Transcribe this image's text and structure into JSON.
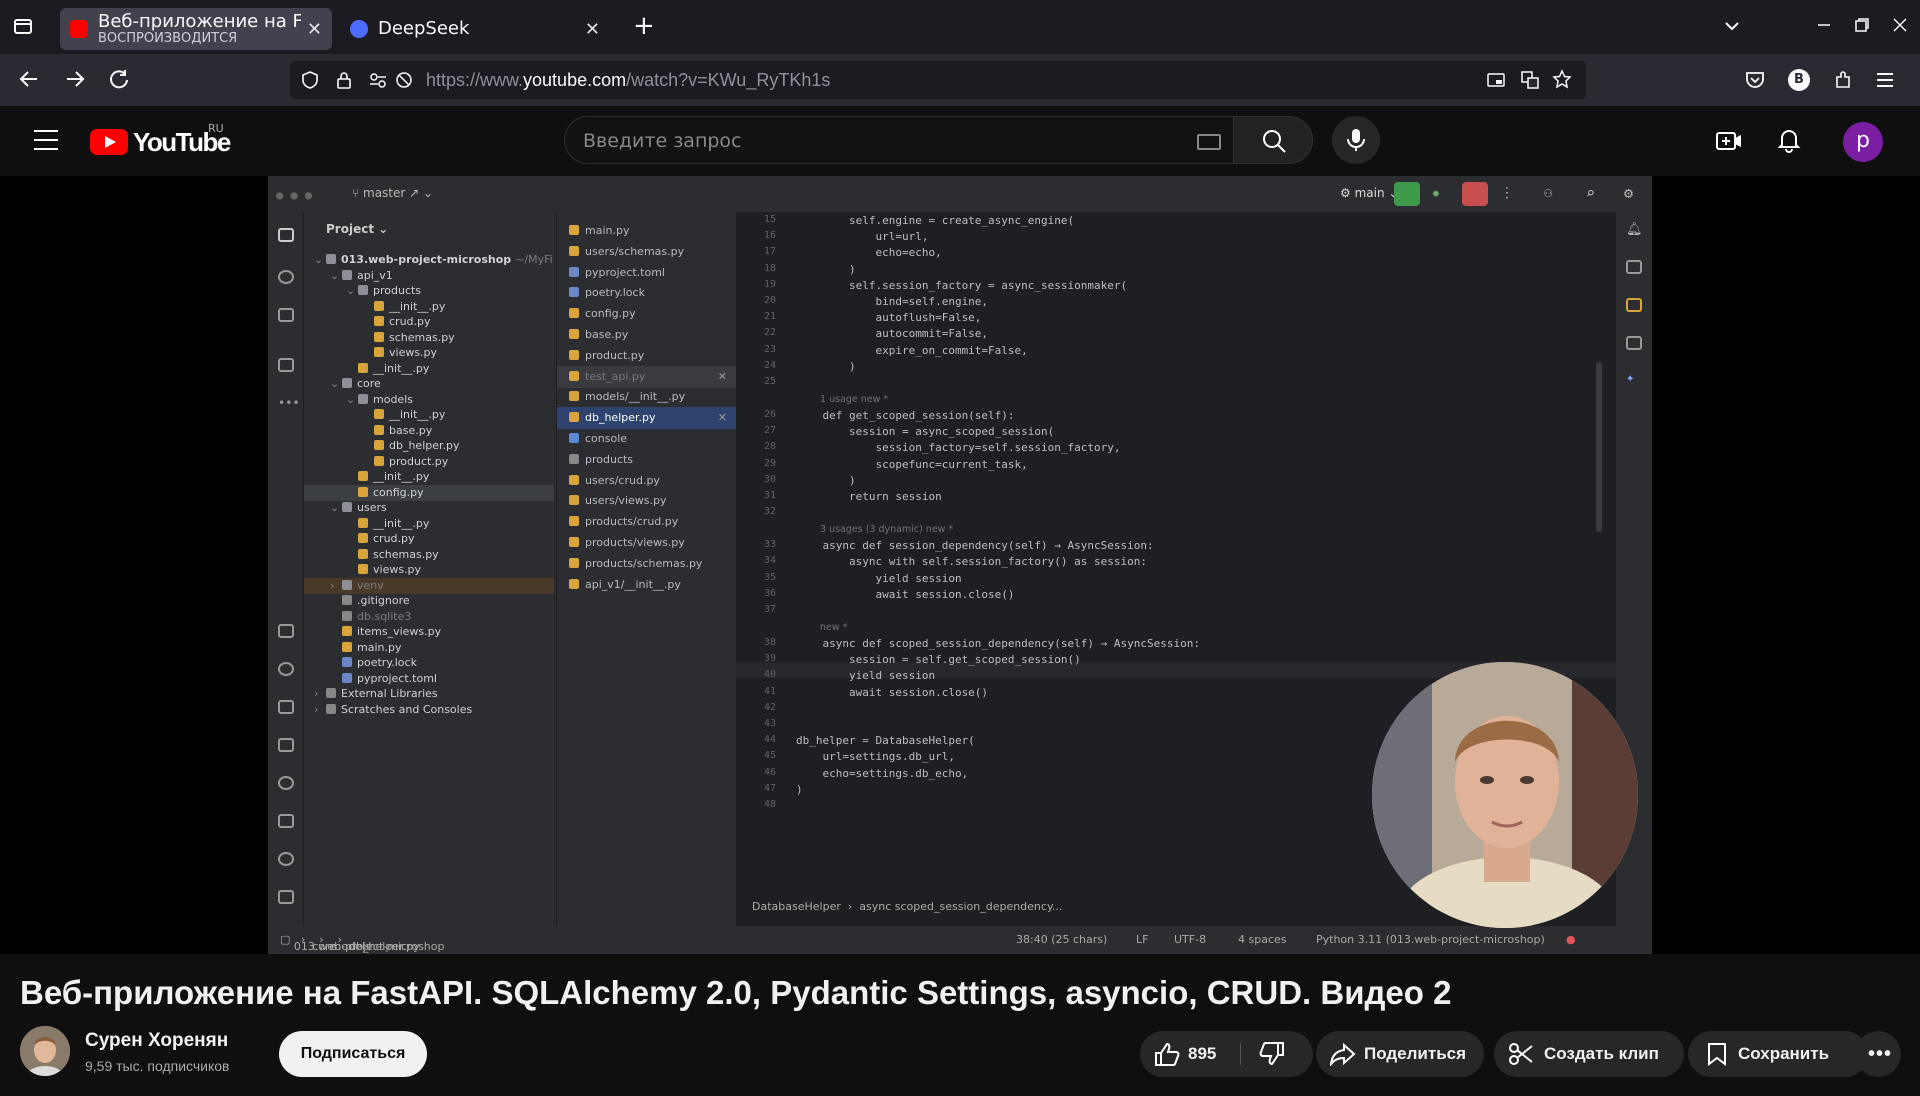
{
  "browser": {
    "tabs": [
      {
        "title": "Веб-приложение на FastAPI",
        "subtitle": "ВОСПРОИЗВОДИТСЯ",
        "active": true
      },
      {
        "title": "DeepSeek",
        "active": false
      }
    ],
    "url_prefix": "https://www.",
    "url_domain": "youtube.com",
    "url_path": "/watch?v=KWu_RyTKh1s",
    "profile_initial": "B"
  },
  "youtube": {
    "logo_text": "YouTube",
    "region": "RU",
    "search_placeholder": "Введите запрос",
    "avatar_initial": "p"
  },
  "ide": {
    "branch": "master",
    "run_config": "main",
    "project_label": "Project",
    "tree": [
      {
        "indent": 0,
        "label": "013.web-project-microshop",
        "suffix": "~/MyFi",
        "kind": "folder",
        "bold": true
      },
      {
        "indent": 1,
        "label": "api_v1",
        "kind": "folder"
      },
      {
        "indent": 2,
        "label": "products",
        "kind": "folder"
      },
      {
        "indent": 3,
        "label": "__init__.py",
        "kind": "py"
      },
      {
        "indent": 3,
        "label": "crud.py",
        "kind": "py"
      },
      {
        "indent": 3,
        "label": "schemas.py",
        "kind": "py"
      },
      {
        "indent": 3,
        "label": "views.py",
        "kind": "py"
      },
      {
        "indent": 2,
        "label": "__init__.py",
        "kind": "py"
      },
      {
        "indent": 1,
        "label": "core",
        "kind": "folder"
      },
      {
        "indent": 2,
        "label": "models",
        "kind": "folder"
      },
      {
        "indent": 3,
        "label": "__init__.py",
        "kind": "py"
      },
      {
        "indent": 3,
        "label": "base.py",
        "kind": "py"
      },
      {
        "indent": 3,
        "label": "db_helper.py",
        "kind": "py"
      },
      {
        "indent": 3,
        "label": "product.py",
        "kind": "py"
      },
      {
        "indent": 2,
        "label": "__init__.py",
        "kind": "py"
      },
      {
        "indent": 2,
        "label": "config.py",
        "kind": "py",
        "selected": true
      },
      {
        "indent": 1,
        "label": "users",
        "kind": "folder"
      },
      {
        "indent": 2,
        "label": "__init__.py",
        "kind": "py"
      },
      {
        "indent": 2,
        "label": "crud.py",
        "kind": "py"
      },
      {
        "indent": 2,
        "label": "schemas.py",
        "kind": "py"
      },
      {
        "indent": 2,
        "label": "views.py",
        "kind": "py"
      },
      {
        "indent": 1,
        "label": "venv",
        "kind": "folder",
        "venv": true
      },
      {
        "indent": 1,
        "label": ".gitignore",
        "kind": "other"
      },
      {
        "indent": 1,
        "label": "db.sqlite3",
        "kind": "other",
        "dim": true
      },
      {
        "indent": 1,
        "label": "items_views.py",
        "kind": "py"
      },
      {
        "indent": 1,
        "label": "main.py",
        "kind": "py"
      },
      {
        "indent": 1,
        "label": "poetry.lock",
        "kind": "toml"
      },
      {
        "indent": 1,
        "label": "pyproject.toml",
        "kind": "toml"
      },
      {
        "indent": 0,
        "label": "External Libraries",
        "kind": "lib"
      },
      {
        "indent": 0,
        "label": "Scratches and Consoles",
        "kind": "lib"
      }
    ],
    "open_files": [
      {
        "label": "main.py"
      },
      {
        "label": "users/schemas.py"
      },
      {
        "label": "pyproject.toml",
        "kind": "toml"
      },
      {
        "label": "poetry.lock",
        "kind": "toml"
      },
      {
        "label": "config.py"
      },
      {
        "label": "base.py"
      },
      {
        "label": "product.py"
      },
      {
        "label": "test_api.py",
        "state": "dim"
      },
      {
        "label": "models/__init__.py"
      },
      {
        "label": "db_helper.py",
        "state": "hl"
      },
      {
        "label": "console",
        "kind": "console"
      },
      {
        "label": "products",
        "kind": "table"
      },
      {
        "label": "users/crud.py"
      },
      {
        "label": "users/views.py"
      },
      {
        "label": "products/crud.py"
      },
      {
        "label": "products/views.py"
      },
      {
        "label": "products/schemas.py"
      },
      {
        "label": "api_v1/__init__.py"
      }
    ],
    "code_lines": [
      {
        "n": "15",
        "text": "        self.engine = create_async_engine("
      },
      {
        "n": "16",
        "text": "            url=url,"
      },
      {
        "n": "17",
        "text": "            echo=echo,"
      },
      {
        "n": "18",
        "text": "        )"
      },
      {
        "n": "19",
        "text": "        self.session_factory = async_sessionmaker("
      },
      {
        "n": "20",
        "text": "            bind=self.engine,"
      },
      {
        "n": "21",
        "text": "            autoflush=False,"
      },
      {
        "n": "22",
        "text": "            autocommit=False,"
      },
      {
        "n": "23",
        "text": "            expire_on_commit=False,"
      },
      {
        "n": "24",
        "text": "        )"
      },
      {
        "n": "25",
        "text": ""
      },
      {
        "hint": "1 usage    new *"
      },
      {
        "n": "26",
        "text": "    def get_scoped_session(self):"
      },
      {
        "n": "27",
        "text": "        session = async_scoped_session("
      },
      {
        "n": "28",
        "text": "            session_factory=self.session_factory,"
      },
      {
        "n": "29",
        "text": "            scopefunc=current_task,"
      },
      {
        "n": "30",
        "text": "        )"
      },
      {
        "n": "31",
        "text": "        return session"
      },
      {
        "n": "32",
        "text": ""
      },
      {
        "hint": "3 usages (3 dynamic)    new *"
      },
      {
        "n": "33",
        "text": "    async def session_dependency(self) → AsyncSession:"
      },
      {
        "n": "34",
        "text": "        async with self.session_factory() as session:"
      },
      {
        "n": "35",
        "text": "            yield session"
      },
      {
        "n": "36",
        "text": "            await session.close()"
      },
      {
        "n": "37",
        "text": ""
      },
      {
        "hint": "new *"
      },
      {
        "n": "38",
        "text": "    async def scoped_session_dependency(self) → AsyncSession:"
      },
      {
        "n": "39",
        "text": "        session = self.get_scoped_session()"
      },
      {
        "n": "40",
        "text": "        yield session"
      },
      {
        "n": "41",
        "text": "        await session.close()"
      },
      {
        "n": "42",
        "text": ""
      },
      {
        "n": "43",
        "text": ""
      },
      {
        "n": "44",
        "text": "db_helper = DatabaseHelper("
      },
      {
        "n": "45",
        "text": "    url=settings.db_url,"
      },
      {
        "n": "46",
        "text": "    echo=settings.db_echo,"
      },
      {
        "n": "47",
        "text": ")"
      },
      {
        "n": "48",
        "text": ""
      }
    ],
    "crumb_class": "DatabaseHelper",
    "crumb_method": "async scoped_session_dependency...",
    "status_path": [
      "013.web-project-microshop",
      "core",
      "models",
      "db_helper.py"
    ],
    "status_pos": "38:40 (25 chars)",
    "status_eol": "LF",
    "status_enc": "UTF-8",
    "status_indent": "4 spaces",
    "status_interp": "Python 3.11 (013.web-project-microshop)"
  },
  "video": {
    "title": "Веб-приложение на FastAPI. SQLAlchemy 2.0, Pydantic Settings, asyncio, CRUD. Видео 2",
    "channel_name": "Сурен Хоренян",
    "channel_subs": "9,59 тыс. подписчиков",
    "subscribe_label": "Подписаться",
    "likes": "895",
    "share_label": "Поделиться",
    "clip_label": "Создать клип",
    "save_label": "Сохранить"
  },
  "colors": {
    "py_icon": "#d9a43a",
    "folder_icon": "#8c9096",
    "toml_icon": "#6c87c8",
    "youtube_red": "#ff0000"
  }
}
